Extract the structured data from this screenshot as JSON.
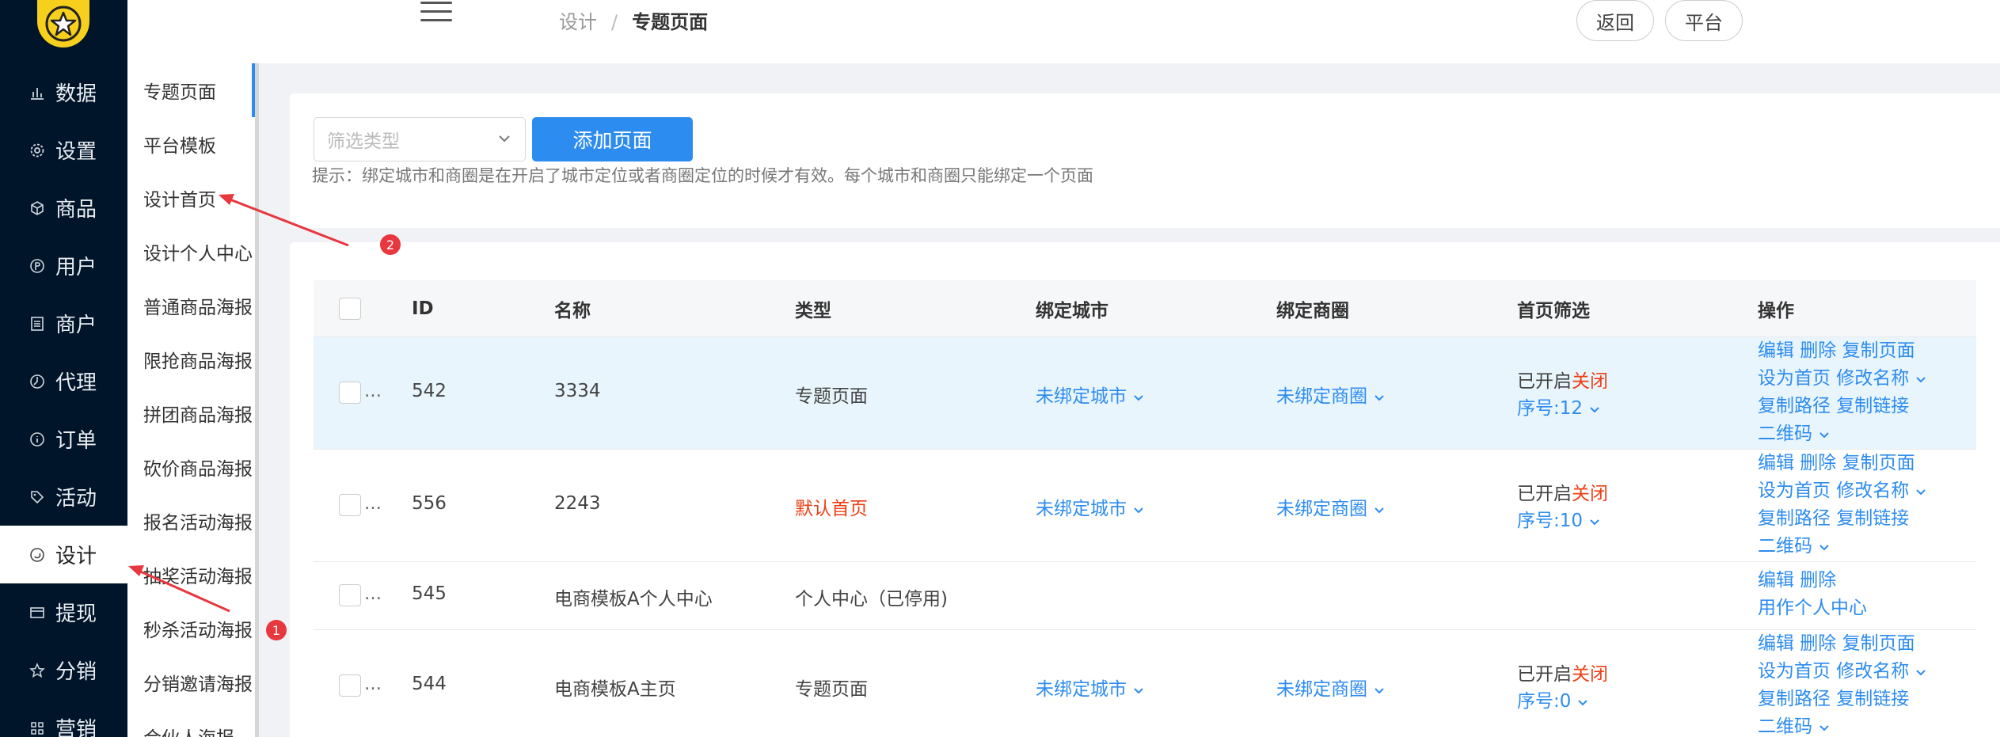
{
  "app": {
    "logo_icon": "star-icon",
    "accent": "#2d8cf0",
    "nav_bg": "#001529"
  },
  "nav": {
    "items": [
      {
        "label": "数据",
        "icon": "bar-chart-icon"
      },
      {
        "label": "设置",
        "icon": "gear-icon"
      },
      {
        "label": "商品",
        "icon": "box-icon"
      },
      {
        "label": "用户",
        "icon": "user-icon"
      },
      {
        "label": "商户",
        "icon": "shop-icon"
      },
      {
        "label": "代理",
        "icon": "agent-icon"
      },
      {
        "label": "订单",
        "icon": "info-icon"
      },
      {
        "label": "活动",
        "icon": "tag-icon"
      },
      {
        "label": "设计",
        "icon": "design-icon"
      },
      {
        "label": "提现",
        "icon": "card-icon"
      },
      {
        "label": "分销",
        "icon": "star-outline-icon"
      },
      {
        "label": "营销",
        "icon": "grid-icon"
      }
    ],
    "active": "设计"
  },
  "submenu": {
    "items": [
      "专题页面",
      "平台模板",
      "设计首页",
      "设计个人中心",
      "普通商品海报",
      "限抢商品海报",
      "拼团商品海报",
      "砍价商品海报",
      "报名活动海报",
      "抽奖活动海报",
      "秒杀活动海报",
      "分销邀请海报",
      "合伙人海报"
    ],
    "active": "专题页面"
  },
  "header": {
    "breadcrumb": [
      "设计",
      "专题页面"
    ],
    "separator": "/",
    "back_label": "返回",
    "platform_label": "平台"
  },
  "filter": {
    "select_placeholder": "筛选类型",
    "add_label": "添加页面",
    "hint": "提示：绑定城市和商圈是在开启了城市定位或者商圈定位的时候才有效。每个城市和商圈只能绑定一个页面"
  },
  "table": {
    "columns": [
      "ID",
      "名称",
      "类型",
      "绑定城市",
      "绑定商圈",
      "首页筛选",
      "操作"
    ],
    "ellipsis": "…",
    "rows": [
      {
        "id": "542",
        "name": "3334",
        "type": "专题页面",
        "city": "未绑定城市",
        "district": "未绑定商圈",
        "filter_on": "已开启",
        "filter_off": "关闭",
        "seq": "序号:12",
        "ops": [
          "编辑 删除 复制页面",
          "设为首页 修改名称",
          "复制路径 复制链接",
          "二维码"
        ]
      },
      {
        "id": "556",
        "name": "2243",
        "type": "默认首页",
        "city": "未绑定城市",
        "district": "未绑定商圈",
        "filter_on": "已开启",
        "filter_off": "关闭",
        "seq": "序号:10",
        "ops": [
          "编辑 删除 复制页面",
          "设为首页 修改名称",
          "复制路径 复制链接",
          "二维码"
        ]
      },
      {
        "id": "545",
        "name": "电商模板A个人中心",
        "type": "个人中心（已停用)",
        "ops": [
          "编辑 删除",
          "用作个人中心"
        ]
      },
      {
        "id": "544",
        "name": "电商模板A主页",
        "type": "专题页面",
        "city": "未绑定城市",
        "district": "未绑定商圈",
        "filter_on": "已开启",
        "filter_off": "关闭",
        "seq": "序号:0",
        "ops": [
          "编辑 删除 复制页面",
          "设为首页 修改名称",
          "复制路径 复制链接",
          "二维码"
        ]
      }
    ]
  },
  "annotations": {
    "marker1": "1",
    "marker2": "2",
    "color": "#e8373e"
  }
}
